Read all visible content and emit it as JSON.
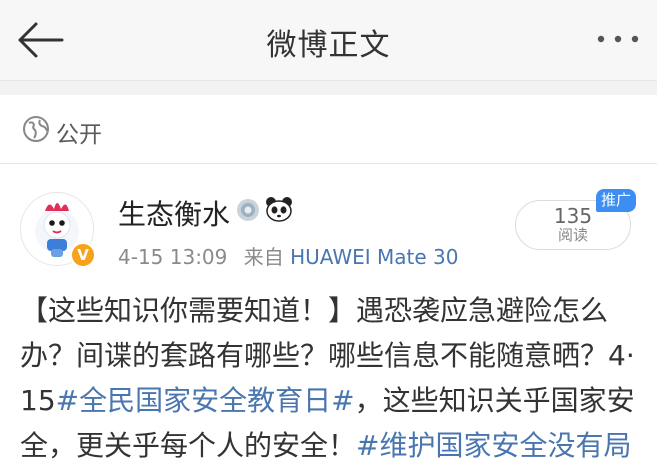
{
  "topbar": {
    "title": "微博正文",
    "back_icon": "arrow-left-icon",
    "more_icon": "more-dots-icon"
  },
  "visibility": {
    "icon": "globe-icon",
    "label": "公开"
  },
  "post": {
    "author": {
      "name": "生态衡水",
      "verified_badge": "V",
      "badges": [
        "medal-icon",
        "panda-icon"
      ]
    },
    "meta": {
      "date": "4-15 13:09",
      "via": "来自",
      "device": "HUAWEI Mate 30"
    },
    "reads": {
      "count": "135",
      "label": "阅读",
      "promo": "推广"
    },
    "content": {
      "t1": "【这些知识你需要知道！】遇恐袭应急避险怎么办？间谍的套路有哪些？哪些信息不能随意晒？4·15",
      "tag1": "#全民国家安全教育日#",
      "t2": "，这些知识关乎国家安全，更关乎每个人的安全！",
      "tag2": "#维护国家安全没有局"
    }
  },
  "colors": {
    "link": "#4a76b0",
    "promo": "#3d8ef3",
    "verified": "#f6a21a",
    "topbar_bg": "#f7f7f7"
  }
}
